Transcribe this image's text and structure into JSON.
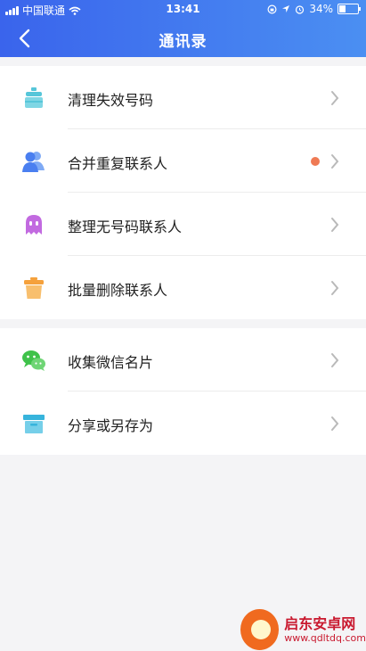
{
  "status_bar": {
    "carrier": "中国联通",
    "time": "13:41",
    "battery": "34%",
    "battery_level": 0.34
  },
  "header": {
    "title": "通讯录",
    "back_icon": "chevron-left-icon"
  },
  "groups": [
    {
      "items": [
        {
          "label": "清理失效号码",
          "icon": "cleaner-icon",
          "color": "#56c6d9"
        },
        {
          "label": "合并重复联系人",
          "icon": "contacts-merge-icon",
          "color": "#4a7ff0",
          "badge_dot": true
        },
        {
          "label": "整理无号码联系人",
          "icon": "ghost-icon",
          "color": "#c26ae0"
        },
        {
          "label": "批量删除联系人",
          "icon": "trash-icon",
          "color": "#f5a13c"
        }
      ]
    },
    {
      "items": [
        {
          "label": "收集微信名片",
          "icon": "wechat-icon",
          "color": "#3fc24a"
        },
        {
          "label": "分享或另存为",
          "icon": "archive-box-icon",
          "color": "#37b4dc"
        }
      ]
    }
  ],
  "colors": {
    "header_gradient_start": "#3a64ec",
    "header_gradient_end": "#4b8ff2",
    "badge_dot": "#ef7a54",
    "background": "#f4f4f6"
  },
  "watermark": {
    "name": "启东安卓网",
    "url": "www.qdltdq.com"
  }
}
